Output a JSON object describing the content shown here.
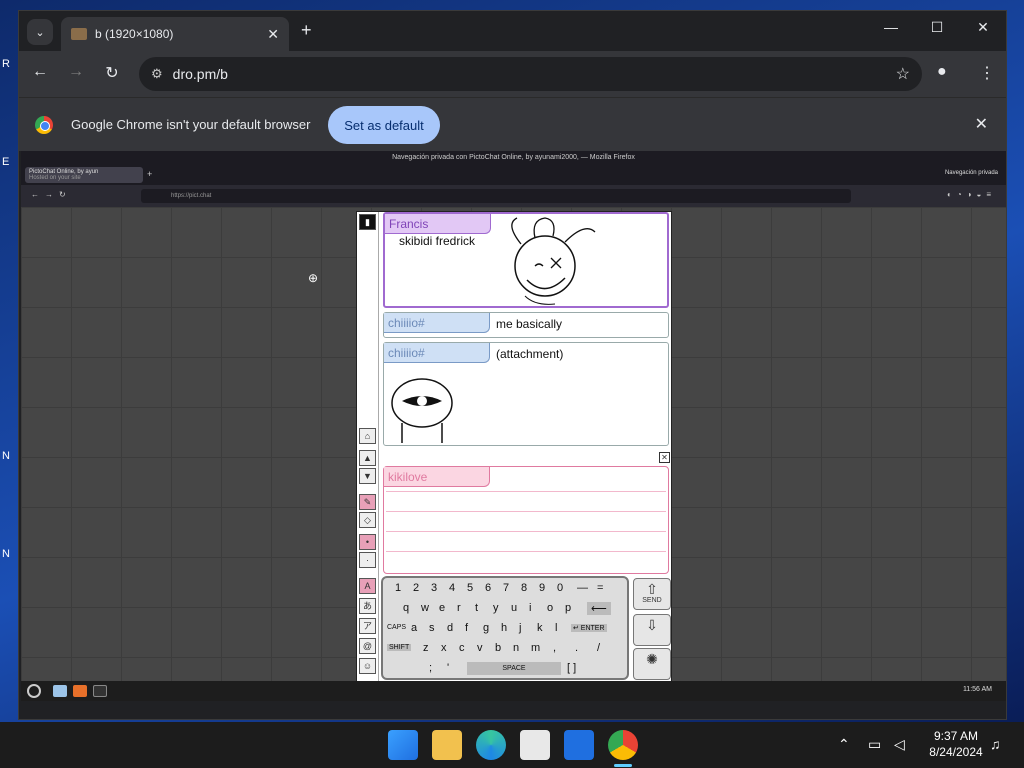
{
  "browser": {
    "tab_title": "b (1920×1080)",
    "new_tab": "+",
    "url": "dro.pm/b",
    "controls": {
      "minimize": "—",
      "maximize": "☐",
      "close": "✕"
    },
    "nav": {
      "back": "←",
      "forward": "→",
      "reload": "↻"
    },
    "infobar": {
      "message": "Google Chrome isn't your default browser",
      "button": "Set as default",
      "close": "✕"
    }
  },
  "remote": {
    "window_title": "Navegación privada con PictoChat Online, by ayunami2000, — Mozilla Firefox",
    "tab_label": "PictoChat Online, by ayun",
    "tab_sub": "Hosted on your site",
    "private_label": "Navegación privada",
    "url": "https://pict.chat",
    "taskbar_clock": "11:56 AM"
  },
  "pictochat": {
    "messages": [
      {
        "name": "Francis",
        "text": "skibidi fredrick",
        "color": "purple"
      },
      {
        "name": "chiiiio#",
        "text": "me basically",
        "color": "blue"
      },
      {
        "name": "chiiiio#",
        "text": "(attachment)",
        "color": "blue"
      }
    ],
    "composer_name": "kikilove",
    "keyboard": {
      "row1": [
        "1",
        "2",
        "3",
        "4",
        "5",
        "6",
        "7",
        "8",
        "9",
        "0",
        "—",
        "="
      ],
      "row2": [
        "q",
        "w",
        "e",
        "r",
        "t",
        "y",
        "u",
        "i",
        "o",
        "p",
        "⟵"
      ],
      "row3_label": "CAPS",
      "row3": [
        "a",
        "s",
        "d",
        "f",
        "g",
        "h",
        "j",
        "k",
        "l"
      ],
      "enter": "↵ ENTER",
      "row4_label": "SHIFT",
      "row4": [
        "z",
        "x",
        "c",
        "v",
        "b",
        "n",
        "m",
        ",",
        ".",
        "/"
      ],
      "row5": [
        ";",
        "'"
      ],
      "space": "SPACE",
      "brackets": "[ ]"
    },
    "send_label": "SEND"
  },
  "system": {
    "time": "9:37 AM",
    "date": "8/24/2024"
  }
}
